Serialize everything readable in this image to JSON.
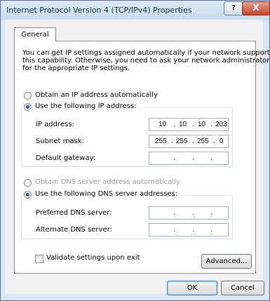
{
  "window": {
    "title": "Internet Protocol Version 4 (TCP/IPv4) Properties",
    "help_label": "?",
    "close_label": "X"
  },
  "tabs": [
    {
      "label": "General"
    }
  ],
  "description": [
    "You can get IP settings assigned automatically if your network supports",
    "this capability. Otherwise, you need to ask your network administrator",
    "for the appropriate IP settings."
  ],
  "ip_mode": {
    "auto": {
      "label": "Obtain an IP address automatically",
      "selected": false
    },
    "manual": {
      "label": "Use the following IP address:",
      "selected": true
    }
  },
  "ip_fields": [
    {
      "label": "IP address:",
      "octets": [
        "10",
        "10",
        "10",
        "203"
      ]
    },
    {
      "label": "Subnet mask:",
      "octets": [
        "255",
        "255",
        "255",
        "0"
      ]
    },
    {
      "label": "Default gateway:",
      "octets": [
        "",
        "",
        "",
        ""
      ]
    }
  ],
  "dns_mode": {
    "auto": {
      "label": "Obtain DNS server address automatically",
      "selected": false,
      "enabled": false
    },
    "manual": {
      "label": "Use the following DNS server addresses:",
      "selected": true
    }
  },
  "dns_fields": [
    {
      "label": "Preferred DNS server:",
      "octets": [
        "",
        "",
        "",
        ""
      ]
    },
    {
      "label": "Alternate DNS server:",
      "octets": [
        "",
        "",
        "",
        ""
      ]
    }
  ],
  "validate": {
    "label": "Validate settings upon exit",
    "checked": false
  },
  "buttons": {
    "advanced": "Advanced...",
    "ok": "OK",
    "cancel": "Cancel"
  }
}
